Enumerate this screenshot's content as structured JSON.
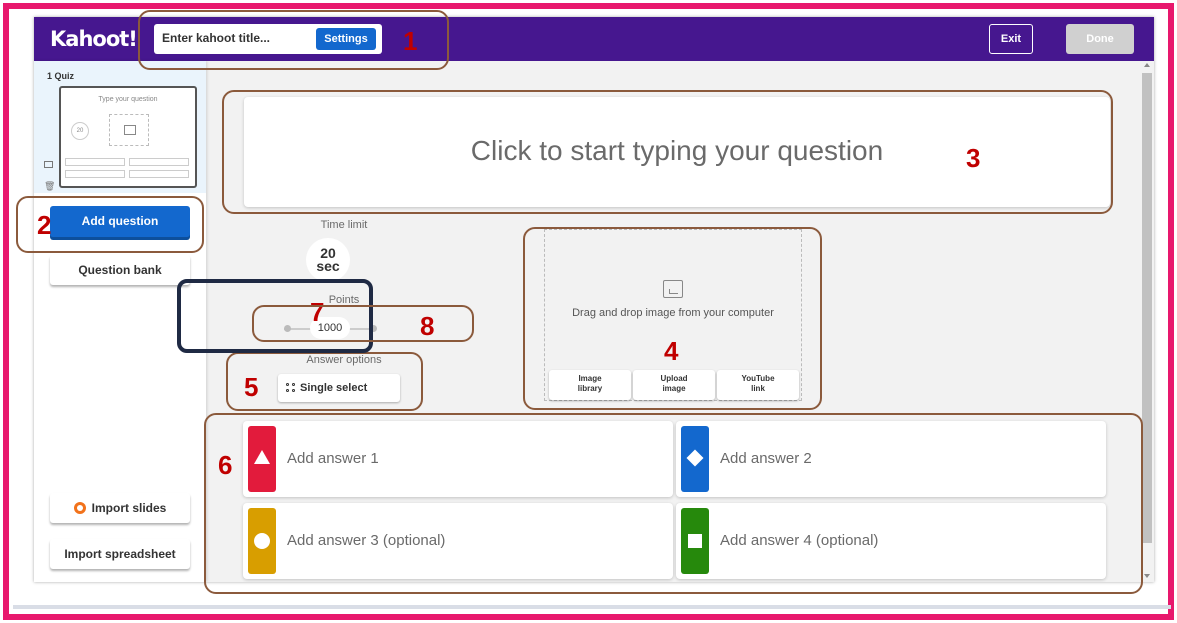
{
  "topbar": {
    "logo": "Kahoot!",
    "title_placeholder": "Enter kahoot title...",
    "settings_label": "Settings",
    "exit_label": "Exit",
    "done_label": "Done"
  },
  "sidebar": {
    "slide_label": "1  Quiz",
    "thumb_question": "Type your question",
    "thumb_time": "20",
    "add_question_label": "Add question",
    "question_bank_label": "Question bank",
    "import_slides_label": "Import slides",
    "import_spreadsheet_label": "Import spreadsheet"
  },
  "question": {
    "placeholder": "Click to start typing your question"
  },
  "settings": {
    "time_limit_label": "Time limit",
    "time_value": "20",
    "time_unit": "sec",
    "points_label": "Points",
    "points_value": "1000",
    "answer_options_label": "Answer options",
    "answer_option_value": "Single select"
  },
  "media": {
    "drag_text": "Drag and drop image from your computer",
    "image_library_l1": "Image",
    "image_library_l2": "library",
    "upload_image_l1": "Upload",
    "upload_image_l2": "image",
    "youtube_l1": "YouTube",
    "youtube_l2": "link"
  },
  "answers": [
    {
      "placeholder": "Add answer 1",
      "color": "#e21b3c",
      "shape": "triangle"
    },
    {
      "placeholder": "Add answer 2",
      "color": "#1368ce",
      "shape": "diamond"
    },
    {
      "placeholder": "Add answer 3 (optional)",
      "color": "#d89e00",
      "shape": "circle"
    },
    {
      "placeholder": "Add answer 4 (optional)",
      "color": "#26890c",
      "shape": "square"
    }
  ],
  "annotations": {
    "n1": "1",
    "n2": "2",
    "n3": "3",
    "n4": "4",
    "n5": "5",
    "n6": "6",
    "n7": "7",
    "n8": "8"
  },
  "colors": {
    "brand_purple": "#46178f",
    "primary_blue": "#1368ce",
    "frame_pink": "#e8186d",
    "annotation_red": "#c00000"
  }
}
